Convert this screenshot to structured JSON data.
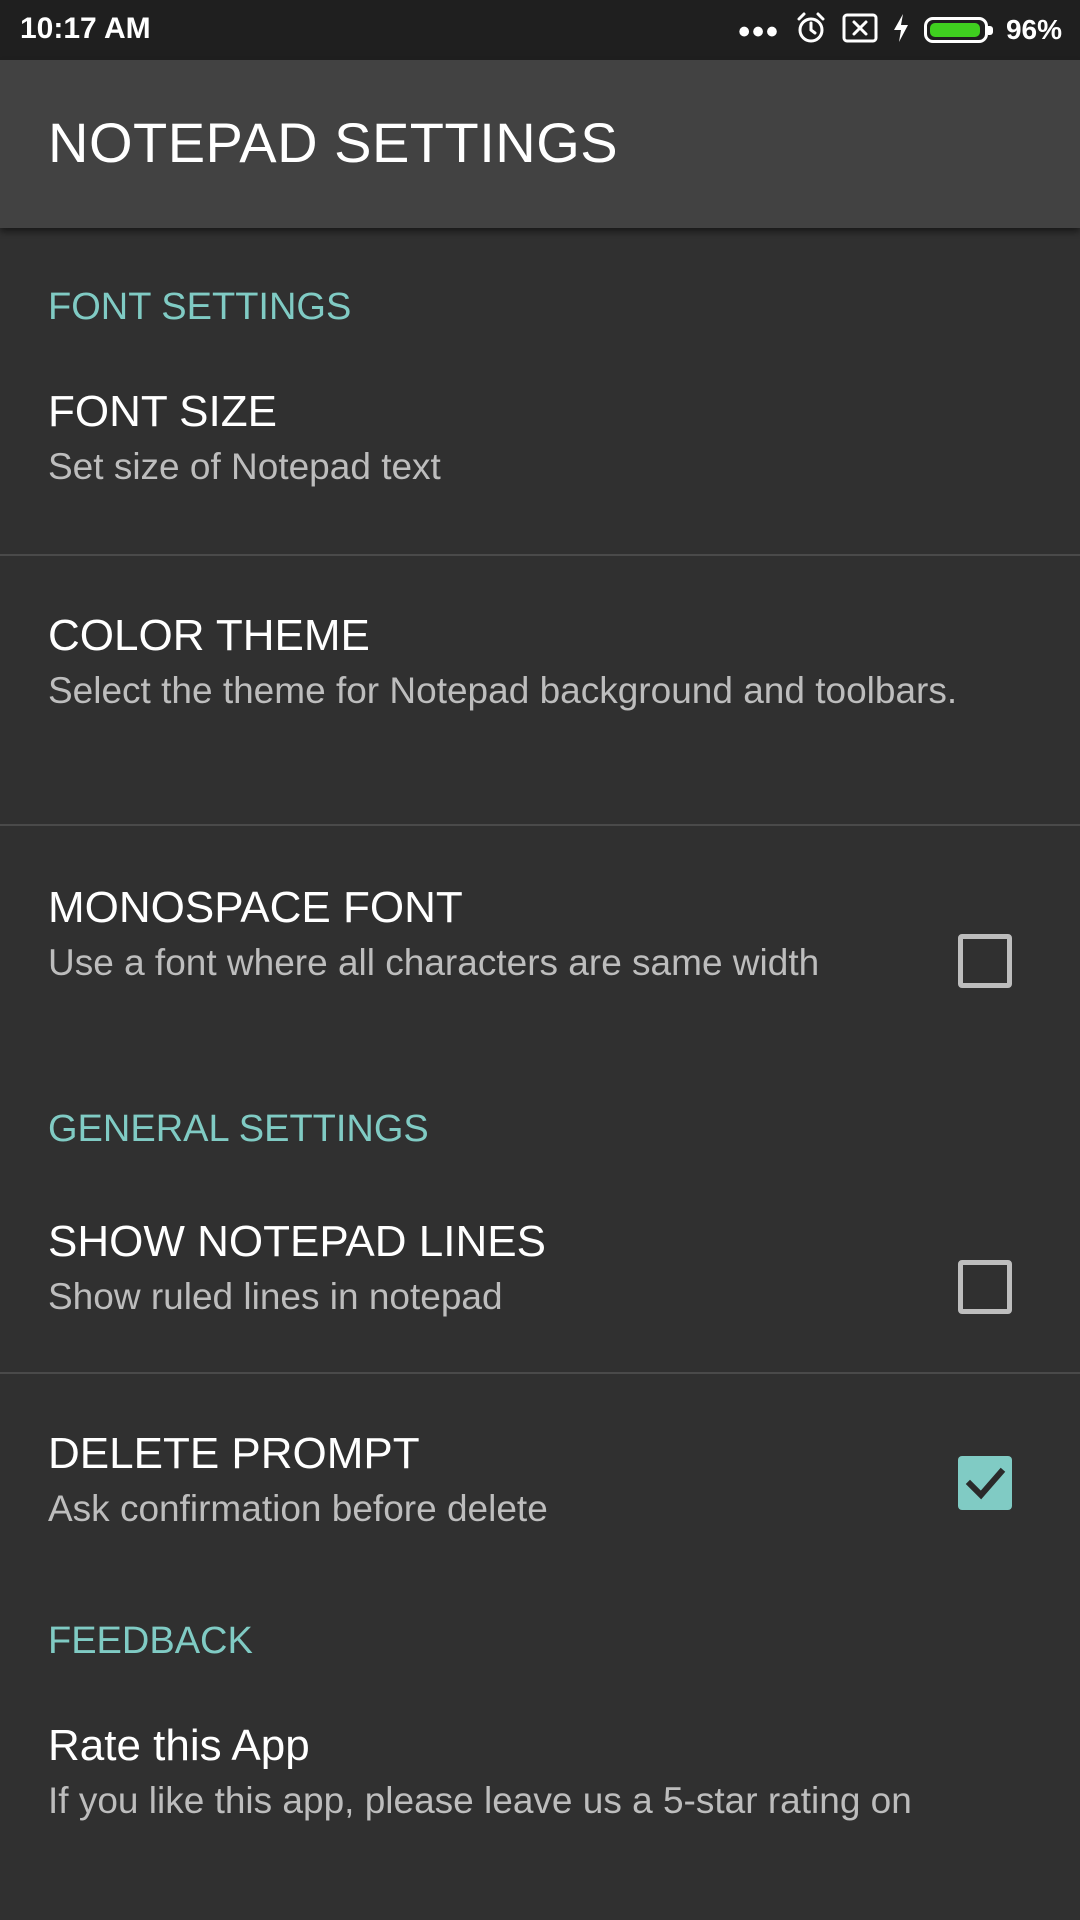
{
  "status_bar": {
    "time": "10:17 AM",
    "dots": "•••",
    "battery_percent_label": "96%",
    "battery_level": 0.96,
    "icons": [
      "more-dots-icon",
      "alarm-icon",
      "notification-x-icon",
      "charging-bolt-icon",
      "battery-icon"
    ]
  },
  "app_bar": {
    "title": "NOTEPAD SETTINGS"
  },
  "sections": {
    "font": {
      "header": "FONT SETTINGS",
      "font_size": {
        "title": "FONT SIZE",
        "summary": "Set size of Notepad text"
      },
      "color_theme": {
        "title": "COLOR THEME",
        "summary": "Select the theme for Notepad background and toolbars."
      },
      "monospace": {
        "title": "MONOSPACE FONT",
        "summary": "Use a font where all characters are same width",
        "checked": false
      }
    },
    "general": {
      "header": "GENERAL SETTINGS",
      "notepad_lines": {
        "title": "SHOW NOTEPAD LINES",
        "summary": "Show ruled lines in notepad",
        "checked": false
      },
      "delete_prompt": {
        "title": "DELETE PROMPT",
        "summary": "Ask confirmation before delete",
        "checked": true
      }
    },
    "feedback": {
      "header": "FEEDBACK",
      "rate": {
        "title": "Rate this App",
        "summary": "If you like this app, please leave us a 5-star rating on"
      }
    }
  },
  "colors": {
    "accent": "#80cbc4",
    "background": "#303030",
    "app_bar": "#424242",
    "status_bar": "#1f1f1f",
    "battery_fill": "#3fcf1f"
  }
}
